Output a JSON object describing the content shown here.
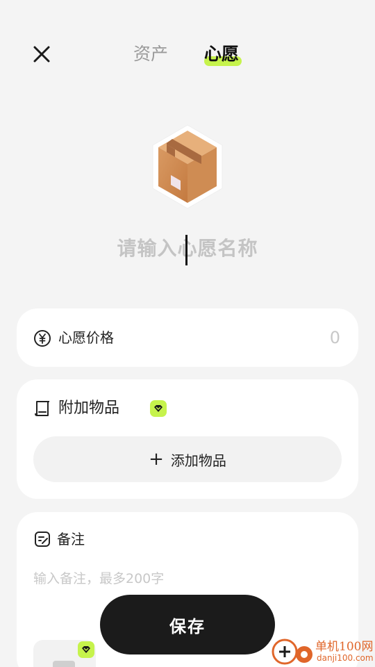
{
  "header": {
    "tabs": [
      {
        "label": "资产",
        "active": false
      },
      {
        "label": "心愿",
        "active": true
      }
    ],
    "close_icon": "close-icon"
  },
  "wish": {
    "icon": "package-box-icon",
    "name_placeholder": "请输入心愿名称"
  },
  "price": {
    "icon": "yen-coin-icon",
    "label": "心愿价格",
    "value": "0"
  },
  "items": {
    "icon": "receipt-icon",
    "label": "附加物品",
    "vip_badge_icon": "vip-gem-icon",
    "add_button_label": "添加物品"
  },
  "notes": {
    "icon": "note-edit-icon",
    "label": "备注",
    "placeholder": "输入备注，最多200字",
    "photo_icon": "image-icon"
  },
  "save_button": {
    "label": "保存"
  },
  "watermark": {
    "line1": "单机100网",
    "line2": "danji100.com"
  },
  "colors": {
    "accent": "#c6f34c",
    "background": "#f4f4f4",
    "button_dark": "#1b1b1b",
    "watermark": "#e0662a"
  }
}
